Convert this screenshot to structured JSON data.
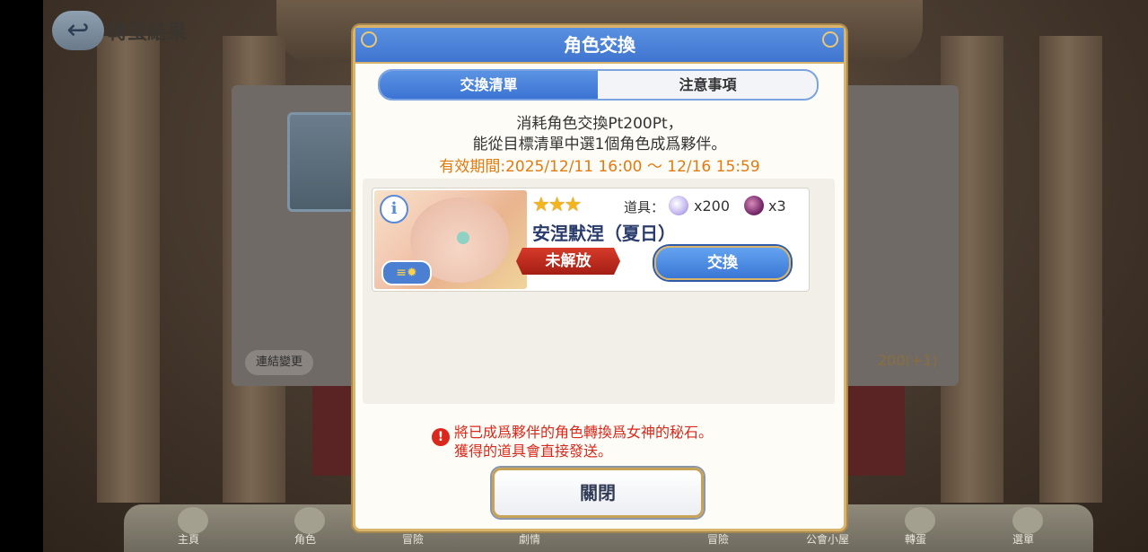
{
  "background": {
    "screen_title": "轉蛋結果",
    "back_icon": "back-arrow-icon",
    "link_label": "連結變更",
    "counter_text": "200(+1)",
    "nav": [
      "主頁",
      "角色",
      "冒險",
      "劇情",
      "冒險",
      "公會小屋",
      "轉蛋",
      "選單"
    ]
  },
  "modal": {
    "title": "角色交換",
    "tabs": {
      "exchange_list": "交換清單",
      "notes": "注意事項"
    },
    "description_line1": "消耗角色交換Pt200Pt，",
    "description_line2": "能從目標清單中選1個角色成爲夥伴。",
    "period": "有效期間:2025/12/11 16:00 ～ 12/16 15:59",
    "card": {
      "info_icon": "info-icon",
      "badge_icon": "exchange-badge-icon",
      "stars": "★★★",
      "rarity": 3,
      "item_label": "道具：",
      "item1_icon": "goddess-stone-icon",
      "item1_qty": "x200",
      "item2_icon": "memory-piece-icon",
      "item2_qty": "x3",
      "character_name": "安涅默涅（夏日）",
      "status": "未解放",
      "exchange_button": "交換"
    },
    "warning_icon": "warning-icon",
    "warning_line1": "將已成爲夥伴的角色轉換爲女神的秘石。",
    "warning_line2": "獲得的道具會直接發送。",
    "close_button": "關閉"
  },
  "colors": {
    "header_blue": "#3f75cf",
    "gold_border": "#d9b46a",
    "period_orange": "#e27a10",
    "warning_red": "#d9281c",
    "locked_red": "#c42d1f"
  }
}
